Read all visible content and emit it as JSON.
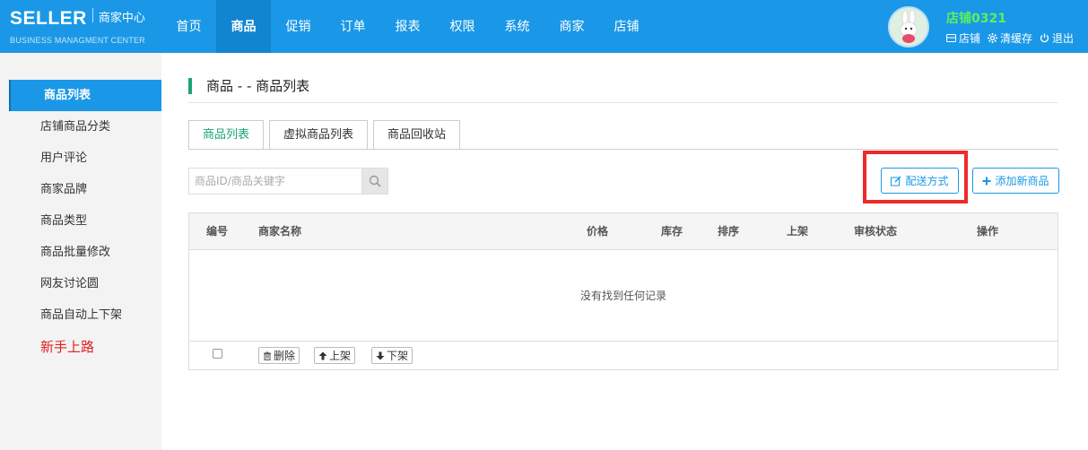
{
  "brand": {
    "name": "SELLER",
    "center": "商家中心",
    "subtitle": "BUSINESS MANAGMENT CENTER"
  },
  "nav": {
    "items": [
      "首页",
      "商品",
      "促销",
      "订单",
      "报表",
      "权限",
      "系统",
      "商家",
      "店铺"
    ],
    "active_index": 1
  },
  "user": {
    "shop_name": "店铺0321",
    "links": [
      "店铺",
      "清缓存",
      "退出"
    ]
  },
  "sidebar": {
    "items": [
      "商品列表",
      "店铺商品分类",
      "用户评论",
      "商家品牌",
      "商品类型",
      "商品批量修改",
      "网友讨论圆",
      "商品自动上下架"
    ],
    "active_index": 0,
    "newbie_link": "新手上路"
  },
  "page": {
    "title": "商品 - - 商品列表"
  },
  "tabs": [
    "商品列表",
    "虚拟商品列表",
    "商品回收站"
  ],
  "search": {
    "placeholder": "商品ID/商品关键字",
    "value": ""
  },
  "actions": {
    "delivery": "配送方式",
    "add": "添加新商品"
  },
  "table": {
    "headers": [
      "编号",
      "商家名称",
      "价格",
      "库存",
      "排序",
      "上架",
      "审核状态",
      "操作"
    ],
    "empty_message": "没有找到任何记录",
    "footer_buttons": [
      "删除",
      "上架",
      "下架"
    ]
  },
  "colors": {
    "topbar": "#1a98e7",
    "accent_green": "#1aa37a",
    "highlight": "#ee2a2a",
    "shop_name": "#5ef05e",
    "newbie": "#e02020"
  }
}
